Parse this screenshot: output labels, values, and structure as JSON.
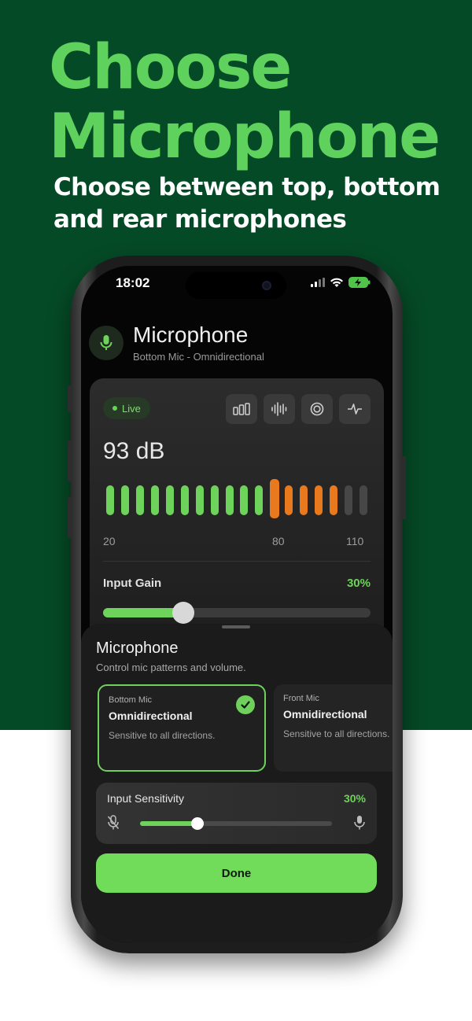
{
  "promo": {
    "headline_line1": "Choose",
    "headline_line2": "Microphone",
    "subhead_line1": "Choose between top, bottom",
    "subhead_line2": "and rear microphones",
    "colors": {
      "background": "#054a26",
      "headline": "#5ed25c",
      "subhead": "#ffffff"
    }
  },
  "status_bar": {
    "time": "18:02",
    "icons": [
      "cellular-signal-icon",
      "wifi-icon",
      "battery-charging-icon"
    ]
  },
  "header": {
    "icon": "microphone-icon",
    "title": "Microphone",
    "subtitle": "Bottom Mic - Omnidirectional"
  },
  "meter": {
    "live_label": "Live",
    "modes": [
      "bar-meter-icon",
      "waveform-icon",
      "target-icon",
      "pulse-icon"
    ],
    "level_readout": "93 dB",
    "bar_count": 18,
    "green_bars": 11,
    "orange_bars": 5,
    "scale": [
      "20",
      "80",
      "110"
    ],
    "colors": {
      "green": "#6dd35a",
      "orange": "#e87a1d",
      "inactive": "#474747"
    }
  },
  "input_gain": {
    "label": "Input Gain",
    "value_label": "30%",
    "value": 0.3
  },
  "sheet": {
    "title": "Microphone",
    "subtitle": "Control mic patterns and volume.",
    "options": [
      {
        "label": "Bottom Mic",
        "pattern": "Omnidirectional",
        "description": "Sensitive to all directions.",
        "selected": true
      },
      {
        "label": "Front Mic",
        "pattern": "Omnidirectional",
        "description": "Sensitive to all directions.",
        "selected": false
      }
    ],
    "sensitivity": {
      "label": "Input Sensitivity",
      "value_label": "30%",
      "value": 0.3,
      "icons": [
        "mic-off-icon",
        "mic-icon"
      ]
    },
    "done_label": "Done",
    "colors": {
      "accent": "#71db5a"
    }
  }
}
